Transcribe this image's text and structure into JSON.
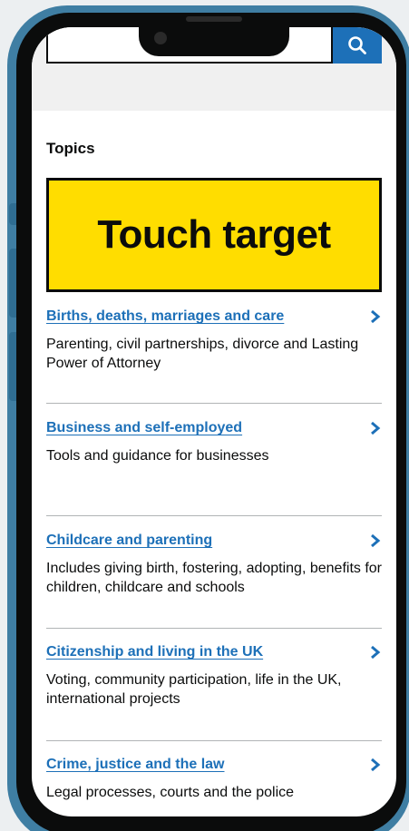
{
  "search": {
    "placeholder": ""
  },
  "colors": {
    "brand_blue": "#1d70b8",
    "yellow": "#ffdd00",
    "text": "#0b0c0c",
    "frame": "#3f7ea3"
  },
  "topics_heading": "Topics",
  "touch_target_label": "Touch target",
  "topics": [
    {
      "title": "Births, deaths, marriages and care",
      "desc": "Parenting, civil partnerships, divorce and Lasting Power of Attorney"
    },
    {
      "title": "Business and self-employed",
      "desc": "Tools and guidance for businesses"
    },
    {
      "title": "Childcare and parenting",
      "desc": "Includes giving birth, fostering, adopting, benefits for children, childcare and schools"
    },
    {
      "title": "Citizenship and living in the UK",
      "desc": "Voting, community participation, life in the UK, international projects"
    },
    {
      "title": "Crime, justice and the law",
      "desc": "Legal processes, courts and the police"
    }
  ],
  "icons": {
    "search": "search-icon",
    "chevron": "chevron-right-icon"
  }
}
